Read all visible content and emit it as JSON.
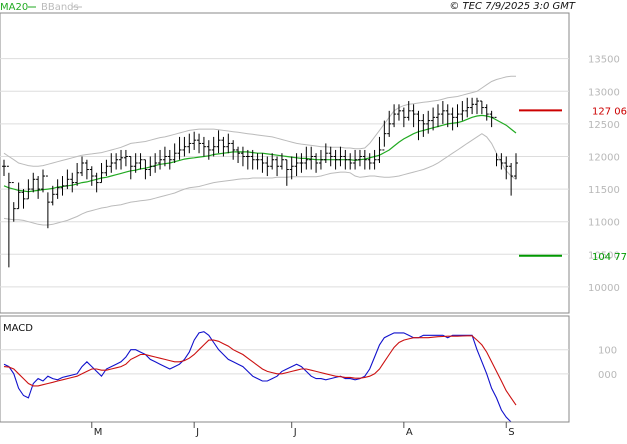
{
  "header": {
    "ma_label": "MA20",
    "bb_label": "BBands",
    "source_text": "© TEC 7/9/2025 3:0 GMT"
  },
  "colors": {
    "ma": "#22aa22",
    "bb": "#bbbbbb",
    "price": "#000000",
    "macd": "#1111cc",
    "signal": "#cc1111",
    "resistance": "#cc0000",
    "support": "#009900",
    "grid": "#dddddd"
  },
  "chart_data": [
    {
      "type": "ohlc",
      "panel": "price",
      "yticks": [
        10000,
        10500,
        11000,
        11500,
        12000,
        12500,
        13000,
        13500
      ],
      "ytick_labels": [
        "10000",
        "10500",
        "11000",
        "11500",
        "12000",
        "12500",
        "13000",
        "13500"
      ],
      "ylim": [
        9600,
        14200
      ],
      "xtick_labels": [
        "M",
        "J",
        "J",
        "A",
        "S"
      ],
      "xtick_index": [
        18,
        39,
        59,
        82,
        103
      ],
      "close": [
        11850,
        11600,
        11200,
        11450,
        11350,
        11500,
        11650,
        11500,
        11700,
        11300,
        11420,
        11520,
        11550,
        11650,
        11600,
        11750,
        11900,
        11800,
        11700,
        11600,
        11750,
        11850,
        11900,
        11950,
        11980,
        12000,
        11850,
        11900,
        11950,
        11800,
        11850,
        11900,
        11950,
        12000,
        11950,
        12050,
        12100,
        12150,
        12200,
        12250,
        12200,
        12150,
        12100,
        12150,
        12250,
        12150,
        12200,
        12100,
        12050,
        12000,
        12000,
        11950,
        11950,
        11900,
        11850,
        11950,
        11850,
        11950,
        11800,
        11850,
        11900,
        11900,
        11950,
        12000,
        11900,
        11950,
        12050,
        12000,
        11950,
        12000,
        11950,
        11900,
        11950,
        12000,
        11950,
        11900,
        11950,
        12100,
        12350,
        12500,
        12650,
        12700,
        12600,
        12700,
        12650,
        12550,
        12500,
        12550,
        12600,
        12650,
        12700,
        12650,
        12600,
        12650,
        12700,
        12750,
        12800,
        12850,
        12750,
        12650,
        12600,
        11950,
        11900,
        11850,
        11700,
        11900
      ],
      "high": [
        11950,
        11750,
        11300,
        11600,
        11500,
        11650,
        11750,
        11700,
        11800,
        11450,
        11550,
        11650,
        11700,
        11800,
        11750,
        11900,
        12000,
        11950,
        11850,
        11750,
        11900,
        11950,
        12050,
        12050,
        12100,
        12100,
        12000,
        12050,
        12050,
        11950,
        12000,
        12050,
        12100,
        12150,
        12100,
        12200,
        12300,
        12300,
        12350,
        12380,
        12350,
        12300,
        12250,
        12300,
        12400,
        12300,
        12350,
        12250,
        12150,
        12150,
        12100,
        12100,
        12050,
        12050,
        12000,
        12050,
        12000,
        12050,
        11950,
        12000,
        12050,
        12050,
        12150,
        12150,
        12050,
        12100,
        12200,
        12150,
        12100,
        12150,
        12100,
        12050,
        12100,
        12100,
        12100,
        12050,
        12100,
        12300,
        12550,
        12700,
        12800,
        12800,
        12750,
        12850,
        12800,
        12700,
        12650,
        12700,
        12750,
        12800,
        12850,
        12800,
        12750,
        12800,
        12850,
        12900,
        12900,
        12900,
        12850,
        12800,
        12700,
        12050,
        12050,
        12000,
        11900,
        12050
      ],
      "low": [
        11700,
        10300,
        11000,
        11200,
        11200,
        11350,
        11450,
        11350,
        11450,
        10900,
        11250,
        11350,
        11400,
        11500,
        11450,
        11550,
        11700,
        11650,
        11550,
        11450,
        11600,
        11700,
        11750,
        11800,
        11800,
        11850,
        11650,
        11750,
        11800,
        11650,
        11700,
        11750,
        11800,
        11850,
        11800,
        11900,
        11950,
        12000,
        12050,
        12100,
        12050,
        12000,
        11950,
        12000,
        12050,
        12000,
        12050,
        11950,
        11900,
        11850,
        11800,
        11800,
        11800,
        11750,
        11700,
        11800,
        11700,
        11800,
        11550,
        11650,
        11700,
        11750,
        11800,
        11800,
        11750,
        11800,
        11900,
        11850,
        11800,
        11850,
        11800,
        11800,
        11800,
        11850,
        11800,
        11800,
        11800,
        11900,
        12150,
        12300,
        12450,
        12550,
        12450,
        12550,
        12450,
        12250,
        12300,
        12350,
        12400,
        12450,
        12500,
        12450,
        12400,
        12450,
        12550,
        12600,
        12650,
        12650,
        12650,
        12550,
        12450,
        11850,
        11800,
        11650,
        11400,
        11650
      ],
      "ma20": [
        11550,
        11520,
        11500,
        11480,
        11470,
        11460,
        11470,
        11480,
        11490,
        11500,
        11510,
        11530,
        11540,
        11550,
        11560,
        11580,
        11600,
        11610,
        11630,
        11650,
        11670,
        11680,
        11700,
        11720,
        11740,
        11760,
        11780,
        11790,
        11810,
        11820,
        11840,
        11860,
        11880,
        11890,
        11900,
        11920,
        11940,
        11960,
        11970,
        11980,
        11990,
        12000,
        12010,
        12030,
        12040,
        12050,
        12060,
        12070,
        12070,
        12070,
        12070,
        12060,
        12050,
        12050,
        12040,
        12030,
        12020,
        12010,
        12000,
        11990,
        11980,
        11970,
        11970,
        11960,
        11950,
        11950,
        11950,
        11950,
        11950,
        11950,
        11950,
        11950,
        11940,
        11950,
        11960,
        11980,
        12000,
        12020,
        12060,
        12100,
        12160,
        12220,
        12270,
        12310,
        12350,
        12380,
        12400,
        12420,
        12440,
        12460,
        12480,
        12500,
        12510,
        12520,
        12540,
        12570,
        12600,
        12620,
        12630,
        12620,
        12600,
        12560,
        12520,
        12480,
        12420,
        12360
      ],
      "bb_upper": [
        12050,
        12000,
        11950,
        11900,
        11880,
        11860,
        11850,
        11850,
        11860,
        11880,
        11900,
        11920,
        11940,
        11960,
        11980,
        12000,
        12020,
        12030,
        12040,
        12050,
        12060,
        12080,
        12100,
        12120,
        12140,
        12170,
        12200,
        12210,
        12220,
        12230,
        12250,
        12270,
        12290,
        12300,
        12320,
        12340,
        12360,
        12380,
        12400,
        12410,
        12420,
        12420,
        12420,
        12420,
        12410,
        12400,
        12390,
        12380,
        12370,
        12360,
        12350,
        12340,
        12330,
        12320,
        12310,
        12300,
        12280,
        12260,
        12240,
        12220,
        12200,
        12190,
        12180,
        12170,
        12160,
        12150,
        12150,
        12140,
        12140,
        12140,
        12130,
        12130,
        12120,
        12120,
        12130,
        12200,
        12300,
        12400,
        12500,
        12600,
        12700,
        12750,
        12780,
        12800,
        12810,
        12820,
        12830,
        12840,
        12850,
        12860,
        12880,
        12900,
        12910,
        12920,
        12940,
        12960,
        12980,
        13000,
        13050,
        13100,
        13150,
        13180,
        13200,
        13220,
        13230,
        13230
      ],
      "bb_lower": [
        11050,
        11040,
        11030,
        11030,
        11020,
        11000,
        10980,
        10960,
        10950,
        10950,
        10960,
        10980,
        11000,
        11020,
        11050,
        11080,
        11120,
        11150,
        11170,
        11190,
        11210,
        11220,
        11240,
        11250,
        11260,
        11280,
        11300,
        11310,
        11320,
        11330,
        11340,
        11360,
        11380,
        11400,
        11420,
        11440,
        11470,
        11500,
        11520,
        11530,
        11540,
        11560,
        11580,
        11600,
        11610,
        11620,
        11630,
        11640,
        11650,
        11660,
        11660,
        11670,
        11670,
        11670,
        11670,
        11670,
        11680,
        11680,
        11680,
        11690,
        11690,
        11690,
        11690,
        11690,
        11690,
        11700,
        11720,
        11740,
        11750,
        11760,
        11760,
        11750,
        11700,
        11680,
        11690,
        11700,
        11700,
        11690,
        11680,
        11680,
        11690,
        11700,
        11720,
        11740,
        11760,
        11780,
        11800,
        11830,
        11860,
        11900,
        11950,
        12000,
        12050,
        12100,
        12150,
        12200,
        12250,
        12300,
        12350,
        12300,
        12200,
        12050,
        11900,
        11780,
        11700,
        11650
      ],
      "levels": [
        {
          "label": "127 06",
          "value": 12706,
          "color": "#cc0000"
        },
        {
          "label": "104 77",
          "value": 10477,
          "color": "#009900"
        }
      ]
    },
    {
      "type": "line",
      "panel": "macd",
      "title": "MACD",
      "yticks": [
        100,
        0
      ],
      "ytick_labels": [
        "100",
        "000"
      ],
      "ylim": [
        -200,
        240
      ],
      "series": [
        {
          "key": "macd",
          "values": [
            40,
            30,
            0,
            -60,
            -90,
            -100,
            -40,
            -20,
            -30,
            -10,
            -20,
            -25,
            -15,
            -10,
            -5,
            0,
            30,
            50,
            30,
            10,
            -10,
            20,
            30,
            40,
            50,
            70,
            100,
            100,
            90,
            80,
            60,
            50,
            40,
            30,
            20,
            30,
            40,
            60,
            90,
            140,
            170,
            175,
            160,
            130,
            100,
            80,
            60,
            50,
            40,
            30,
            10,
            -10,
            -20,
            -30,
            -30,
            -20,
            -10,
            10,
            20,
            30,
            40,
            30,
            10,
            -10,
            -20,
            -20,
            -25,
            -20,
            -15,
            -10,
            -20,
            -20,
            -25,
            -20,
            -10,
            20,
            70,
            120,
            150,
            160,
            170,
            170,
            170,
            160,
            150,
            150,
            160,
            160,
            160,
            160,
            160,
            150,
            160,
            160,
            160,
            160,
            160,
            100,
            50,
            0,
            -60,
            -100,
            -150,
            -180,
            -200,
            -200
          ]
        },
        {
          "key": "signal",
          "values": [
            30,
            28,
            20,
            0,
            -20,
            -40,
            -50,
            -50,
            -45,
            -40,
            -35,
            -30,
            -25,
            -20,
            -15,
            -10,
            0,
            10,
            20,
            20,
            15,
            15,
            20,
            25,
            30,
            40,
            60,
            70,
            80,
            80,
            75,
            70,
            65,
            60,
            55,
            50,
            50,
            55,
            65,
            80,
            100,
            120,
            140,
            140,
            135,
            125,
            115,
            100,
            90,
            80,
            65,
            50,
            35,
            20,
            10,
            5,
            0,
            0,
            5,
            10,
            15,
            20,
            20,
            15,
            10,
            5,
            0,
            -5,
            -10,
            -12,
            -15,
            -15,
            -18,
            -18,
            -15,
            -10,
            0,
            20,
            50,
            80,
            110,
            130,
            140,
            145,
            150,
            150,
            150,
            150,
            152,
            154,
            155,
            156,
            156,
            156,
            157,
            158,
            158,
            140,
            120,
            90,
            50,
            10,
            -30,
            -70,
            -100,
            -130
          ]
        }
      ]
    }
  ]
}
